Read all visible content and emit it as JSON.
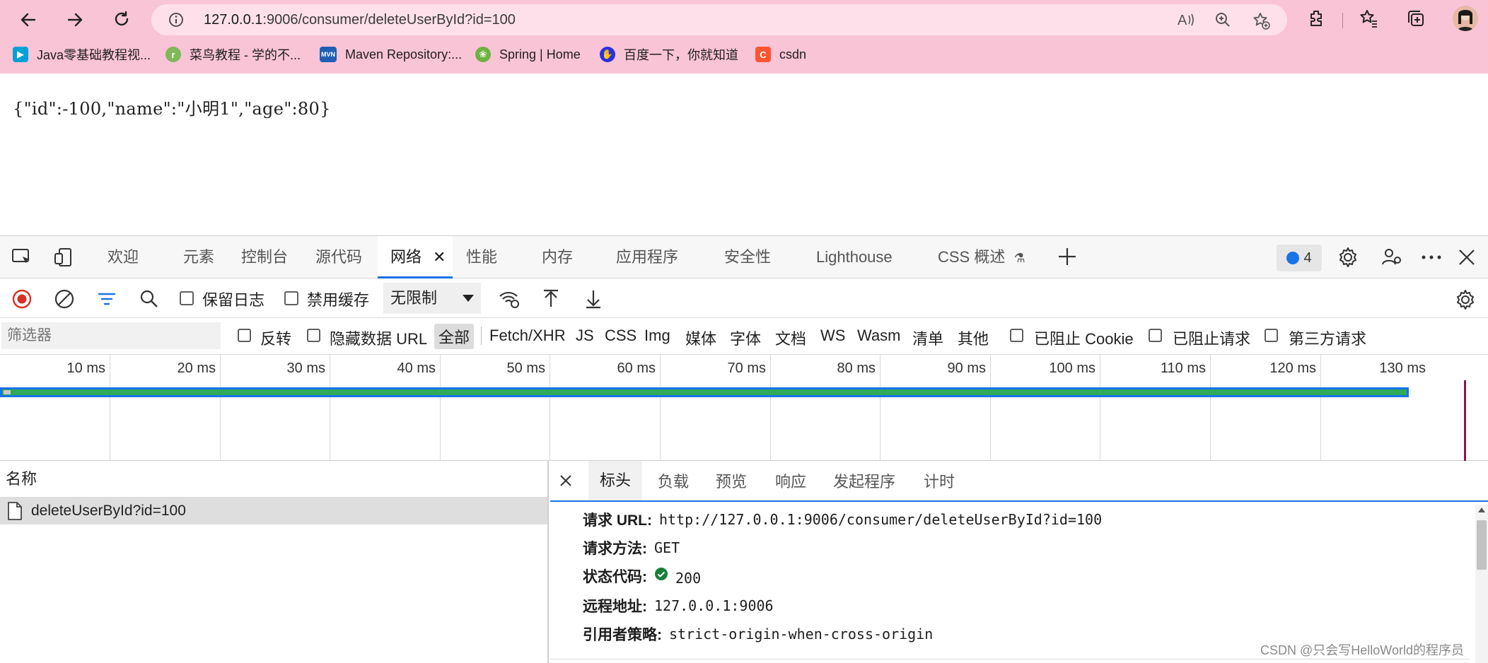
{
  "browser": {
    "address": {
      "host": "127.0.0.1",
      "path": ":9006/consumer/deleteUserById?id=100"
    },
    "bookmarks": [
      {
        "label": "Java零基础教程视...",
        "icon": "bilibili-icon",
        "color": "#00a1d6"
      },
      {
        "label": "菜鸟教程 - 学的不...",
        "icon": "runoob-icon",
        "color": "#7fb85a"
      },
      {
        "label": "Maven Repository:...",
        "icon": "mvn-icon",
        "color": "#1f5fb4"
      },
      {
        "label": "Spring | Home",
        "icon": "spring-icon",
        "color": "#6db33f"
      },
      {
        "label": "百度一下，你就知道",
        "icon": "baidu-icon",
        "color": "#2932e1"
      },
      {
        "label": "csdn",
        "icon": "csdn-icon",
        "color": "#fc5531"
      }
    ]
  },
  "page": {
    "json_text": "{\"id\":-100,\"name\":\"小明1\",\"age\":80}"
  },
  "devtools": {
    "tabs": [
      "欢迎",
      "元素",
      "控制台",
      "源代码",
      "网络",
      "性能",
      "内存",
      "应用程序",
      "安全性",
      "Lighthouse",
      "CSS 概述"
    ],
    "active_tab": "网络",
    "message_count": "4",
    "toolbar": {
      "preserve_log": "保留日志",
      "disable_cache": "禁用缓存",
      "throttle": "无限制"
    },
    "filter": {
      "placeholder": "筛选器",
      "invert": "反转",
      "hide_data_url": "隐藏数据 URL",
      "types": [
        "全部",
        "Fetch/XHR",
        "JS",
        "CSS",
        "Img",
        "媒体",
        "字体",
        "文档",
        "WS",
        "Wasm",
        "清单",
        "其他"
      ],
      "blocked_cookies": "已阻止 Cookie",
      "blocked_requests": "已阻止请求",
      "third_party": "第三方请求"
    },
    "timeline_ticks": [
      "10 ms",
      "20 ms",
      "30 ms",
      "40 ms",
      "50 ms",
      "60 ms",
      "70 ms",
      "80 ms",
      "90 ms",
      "100 ms",
      "110 ms",
      "120 ms",
      "130 ms"
    ],
    "requests": {
      "header": "名称",
      "rows": [
        "deleteUserById?id=100"
      ]
    },
    "details": {
      "tabs": [
        "标头",
        "负载",
        "预览",
        "响应",
        "发起程序",
        "计时"
      ],
      "active": "标头",
      "headers": [
        {
          "key": "请求 URL:",
          "value": "http://127.0.0.1:9006/consumer/deleteUserById?id=100"
        },
        {
          "key": "请求方法:",
          "value": "GET"
        },
        {
          "key": "状态代码:",
          "value": "200"
        },
        {
          "key": "远程地址:",
          "value": "127.0.0.1:9006"
        },
        {
          "key": "引用者策略:",
          "value": "strict-origin-when-cross-origin"
        }
      ]
    }
  },
  "watermark": "CSDN @只会写HelloWorld的程序员"
}
